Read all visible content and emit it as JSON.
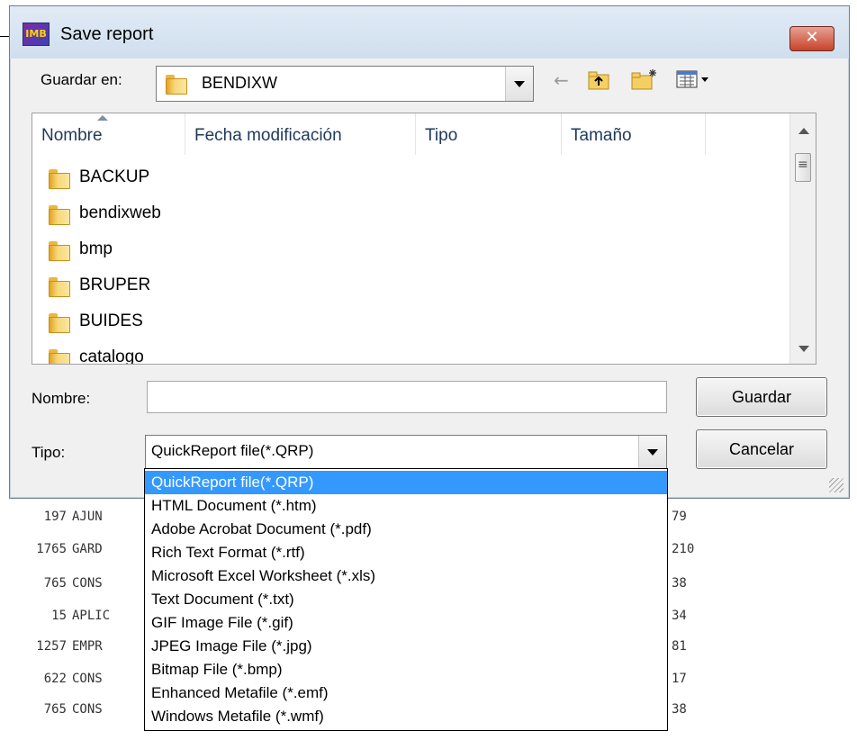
{
  "dialog": {
    "title": "Save report",
    "app_icon_text": "IMB",
    "close_label": "✕"
  },
  "location": {
    "label": "Guardar en:",
    "current": "BENDIXW"
  },
  "toolbar": {
    "icons": [
      "back-arrow-icon",
      "up-folder-icon",
      "new-folder-icon",
      "view-menu-icon"
    ]
  },
  "columns": [
    "Nombre",
    "Fecha modificación",
    "Tipo",
    "Tamaño"
  ],
  "files": [
    {
      "name": "BACKUP"
    },
    {
      "name": "bendixweb"
    },
    {
      "name": "bmp"
    },
    {
      "name": "BRUPER"
    },
    {
      "name": "BUIDES"
    },
    {
      "name": "catalogo"
    }
  ],
  "filename": {
    "label": "Nombre:",
    "value": ""
  },
  "filetype": {
    "label": "Tipo:",
    "value": "QuickReport file(*.QRP)"
  },
  "buttons": {
    "save": "Guardar",
    "cancel": "Cancelar"
  },
  "filetype_options": [
    "QuickReport file(*.QRP)",
    "HTML Document (*.htm)",
    "Adobe Acrobat Document (*.pdf)",
    "Rich Text Format (*.rtf)",
    "Microsoft Excel Worksheet (*.xls)",
    "Text Document (*.txt)",
    "GIF Image File (*.gif)",
    "JPEG Image File (*.jpg)",
    "Bitmap File (*.bmp)",
    "Enhanced Metafile (*.emf)",
    "Windows Metafile (*.wmf)"
  ],
  "selected_option_index": 0,
  "background_report": [
    {
      "num": "197",
      "name": "AJUN",
      "tail": "79"
    },
    {
      "num": "1765",
      "name": "GARD",
      "tail": "210"
    },
    {
      "num": "765",
      "name": "CONS",
      "tail": "38"
    },
    {
      "num": "15",
      "name": "APLIC",
      "tail": "34"
    },
    {
      "num": "1257",
      "name": "EMPR",
      "tail": "81"
    },
    {
      "num": "622",
      "name": "CONS",
      "tail": "17"
    },
    {
      "num": "765",
      "name": "CONS",
      "tail": "38"
    }
  ],
  "colors": {
    "selection": "#3399ff",
    "close_button": "#c7432a",
    "titlebar": "#cfdeee"
  }
}
